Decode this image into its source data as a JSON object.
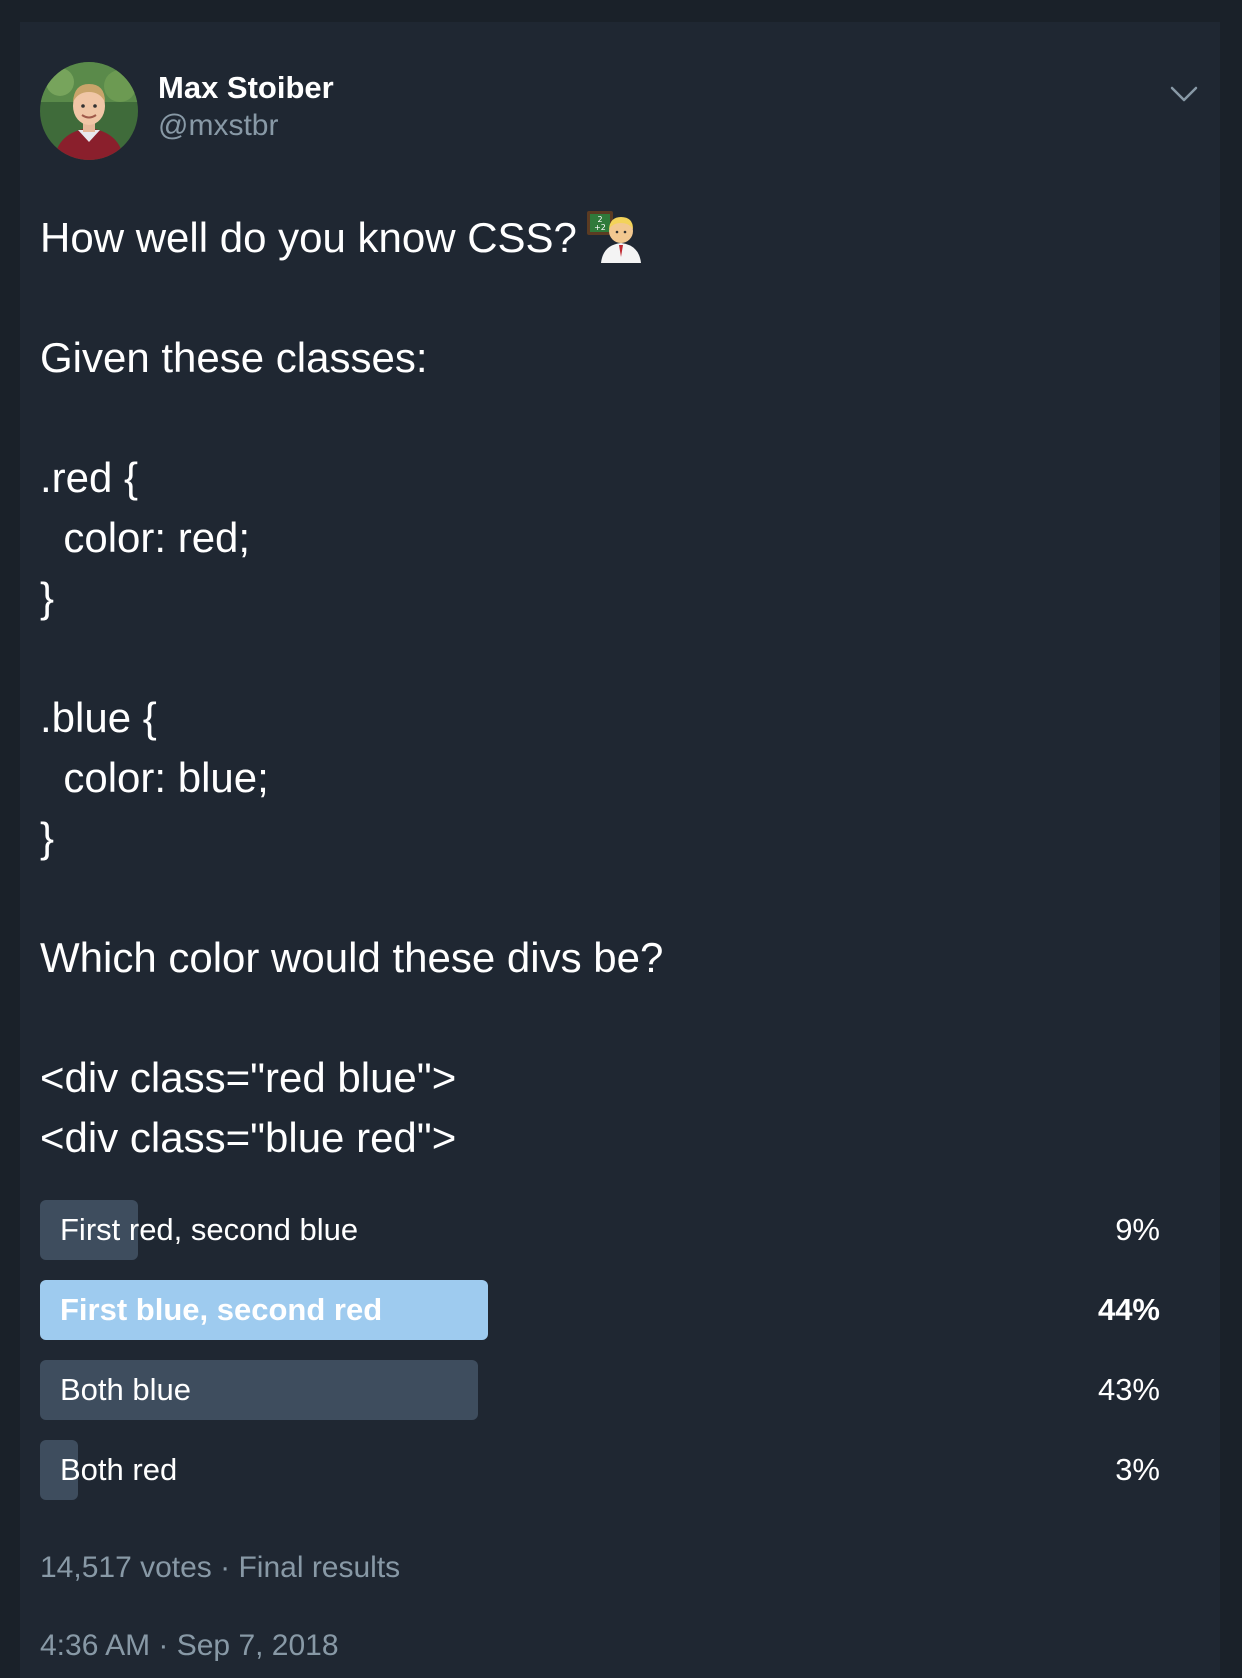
{
  "author": {
    "name": "Max Stoiber",
    "handle": "@mxstbr"
  },
  "tweet": {
    "lines": [
      "How well do you know CSS?",
      "",
      "Given these classes:",
      "",
      ".red {",
      "  color: red;",
      "}",
      "",
      ".blue {",
      "  color: blue;",
      "}",
      "",
      "Which color would these divs be?",
      "",
      "<div class=\"red blue\">",
      "<div class=\"blue red\">"
    ],
    "emoji": "man-teacher-emoji"
  },
  "poll": {
    "options": [
      {
        "label": "First red, second blue",
        "percent_text": "9%",
        "percent": 9,
        "winner": false
      },
      {
        "label": "First blue, second red",
        "percent_text": "44%",
        "percent": 44,
        "winner": true
      },
      {
        "label": "Both blue",
        "percent_text": "43%",
        "percent": 43,
        "winner": false
      },
      {
        "label": "Both red",
        "percent_text": "3%",
        "percent": 3,
        "winner": false
      }
    ],
    "votes_text": "14,517 votes · Final results"
  },
  "timestamp": "4:36 AM · Sep 7, 2018",
  "icons": {
    "menu": "chevron-down-icon",
    "avatar": "avatar-photo"
  },
  "colors": {
    "background": "#1f2732",
    "text": "#ffffff",
    "muted": "#8899a6",
    "bar": "#3e4d5e",
    "bar_winner": "#9ecbef"
  }
}
